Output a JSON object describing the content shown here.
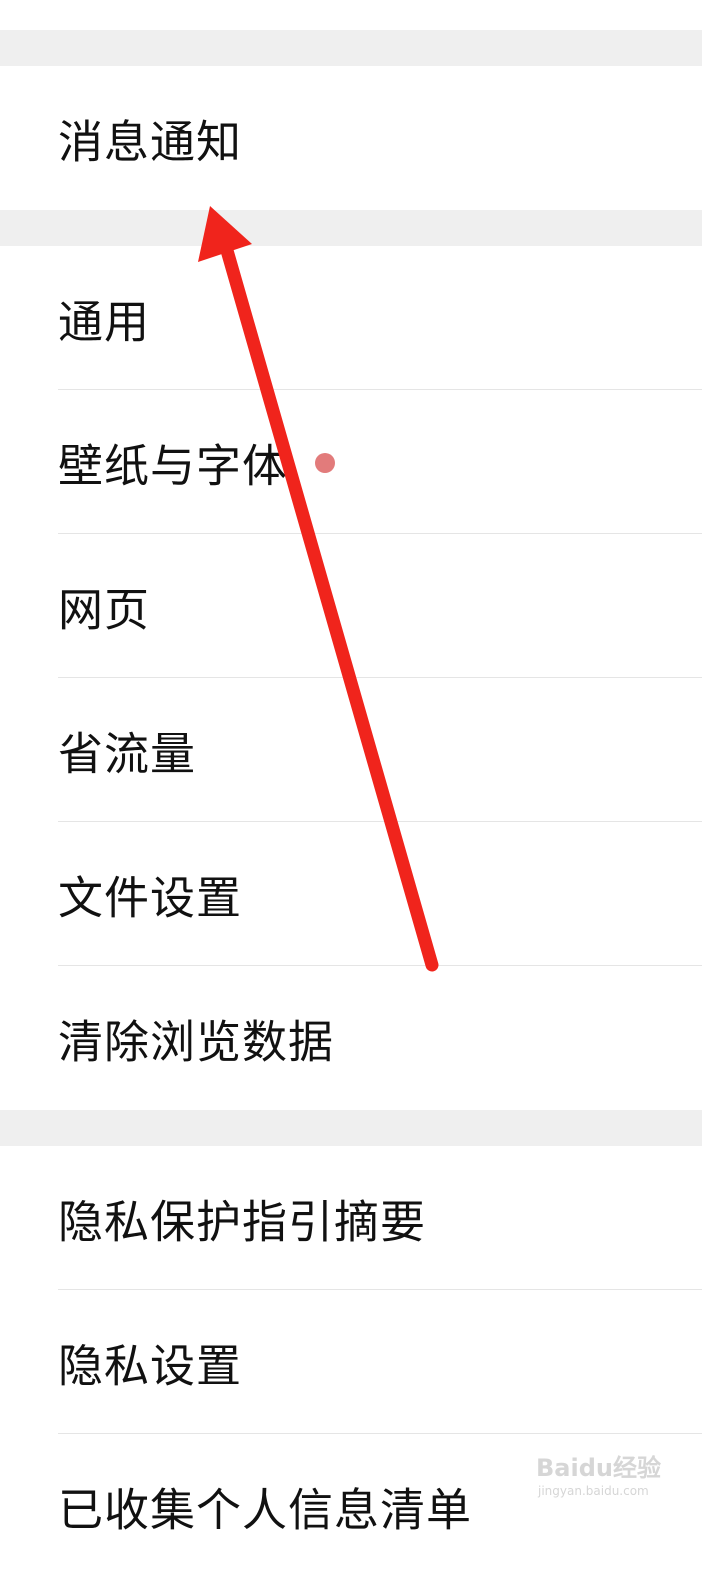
{
  "settings": {
    "groups": [
      {
        "items": [
          {
            "label": "消息通知"
          }
        ]
      },
      {
        "items": [
          {
            "label": "通用"
          },
          {
            "label": "壁纸与字体"
          },
          {
            "label": "网页"
          },
          {
            "label": "省流量"
          },
          {
            "label": "文件设置"
          },
          {
            "label": "清除浏览数据"
          }
        ]
      },
      {
        "items": [
          {
            "label": "隐私保护指引摘要"
          },
          {
            "label": "隐私设置"
          },
          {
            "label": "已收集个人信息清单"
          }
        ]
      }
    ]
  },
  "annotation": {
    "arrow_color": "#f0241c",
    "badge_color": "#e27b7b"
  },
  "watermark": {
    "brand": "Baidu经验",
    "site": "jingyan.baidu.com"
  }
}
